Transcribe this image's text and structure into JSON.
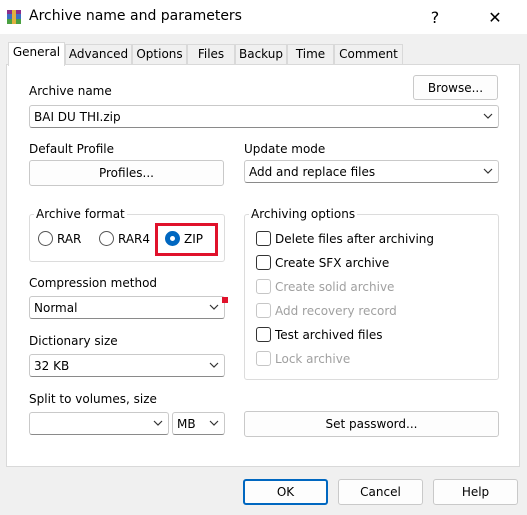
{
  "window": {
    "title": "Archive name and parameters",
    "help_glyph": "?",
    "close_glyph": "✕"
  },
  "tabs": [
    "General",
    "Advanced",
    "Options",
    "Files",
    "Backup",
    "Time",
    "Comment"
  ],
  "general": {
    "archive_name_label": "Archive name",
    "archive_name_value": "BAI DU THI.zip",
    "browse_label": "Browse...",
    "default_profile_label": "Default Profile",
    "profiles_label": "Profiles...",
    "update_mode_label": "Update mode",
    "update_mode_value": "Add and replace files",
    "archive_format_label": "Archive format",
    "formats": [
      {
        "label": "RAR",
        "checked": false
      },
      {
        "label": "RAR4",
        "checked": false
      },
      {
        "label": "ZIP",
        "checked": true
      }
    ],
    "compression_method_label": "Compression method",
    "compression_method_value": "Normal",
    "dictionary_size_label": "Dictionary size",
    "dictionary_size_value": "32 KB",
    "split_label": "Split to volumes, size",
    "split_value": "",
    "split_unit": "MB",
    "archiving_options_label": "Archiving options",
    "options": [
      {
        "label": "Delete files after archiving",
        "checked": false,
        "disabled": false
      },
      {
        "label": "Create SFX archive",
        "checked": false,
        "disabled": false
      },
      {
        "label": "Create solid archive",
        "checked": false,
        "disabled": true
      },
      {
        "label": "Add recovery record",
        "checked": false,
        "disabled": true
      },
      {
        "label": "Test archived files",
        "checked": false,
        "disabled": false
      },
      {
        "label": "Lock archive",
        "checked": false,
        "disabled": true
      }
    ],
    "set_password_label": "Set password..."
  },
  "footer": {
    "ok": "OK",
    "cancel": "Cancel",
    "help": "Help"
  },
  "colors": {
    "accent": "#0067c0",
    "highlight": "#e0112b"
  }
}
